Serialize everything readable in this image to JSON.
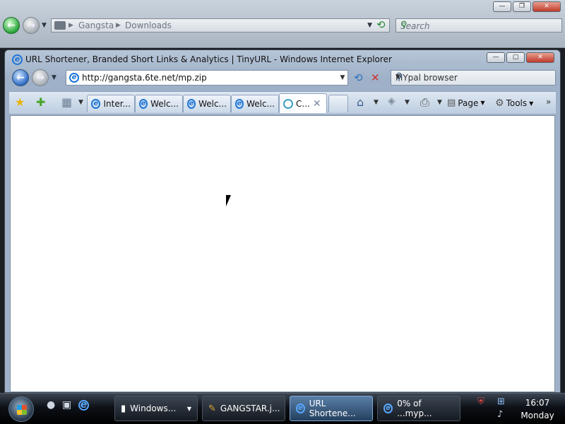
{
  "bg_window": {
    "breadcrumb": [
      "Gangsta",
      "Downloads"
    ],
    "search_placeholder": "Search",
    "caption": {
      "minimize": "—",
      "maximize": "❐",
      "close": "✕"
    }
  },
  "ie_window": {
    "title": "URL Shortener, Branded Short Links & Analytics | TinyURL - Windows Internet Explorer",
    "address": "http://gangsta.6te.net/mp.zip",
    "search_text": "MYpal browser",
    "caption": {
      "minimize": "—",
      "maximize": "▢",
      "close": "✕"
    },
    "tabs": [
      {
        "label": "Inter...",
        "active": false
      },
      {
        "label": "Welc...",
        "active": false
      },
      {
        "label": "Welc...",
        "active": false
      },
      {
        "label": "Welc...",
        "active": false
      },
      {
        "label": "C...",
        "active": true
      }
    ],
    "commands": {
      "page": "Page",
      "tools": "Tools"
    }
  },
  "taskbar": {
    "tasks": [
      {
        "label": "Windows..."
      },
      {
        "label": "GANGSTAR.j..."
      },
      {
        "label": "URL Shortene...",
        "active": true
      },
      {
        "label": "0% of ...myp..."
      }
    ],
    "clock": {
      "time": "16:07",
      "day": "Monday"
    }
  },
  "colors": {
    "accent": "#1d74d6",
    "taskbar_active": "#5a7fa8"
  }
}
